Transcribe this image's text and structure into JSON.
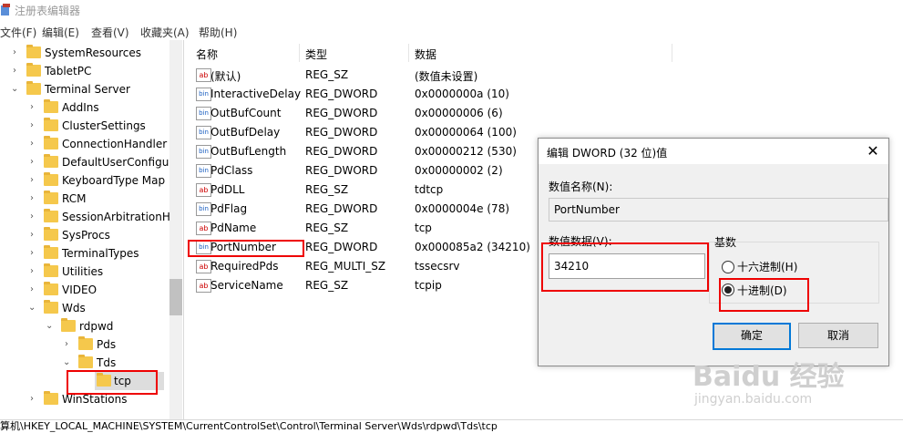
{
  "window": {
    "title": "注册表编辑器"
  },
  "menu": [
    "文件(F)",
    "编辑(E)",
    "查看(V)",
    "收藏夹(A)",
    "帮助(H)"
  ],
  "tree": [
    {
      "label": "SystemResources",
      "chev": "›"
    },
    {
      "label": "TabletPC",
      "chev": "›"
    },
    {
      "label": "Terminal Server",
      "chev": "⌄"
    },
    {
      "label": "AddIns",
      "chev": "›"
    },
    {
      "label": "ClusterSettings",
      "chev": "›"
    },
    {
      "label": "ConnectionHandler",
      "chev": "›"
    },
    {
      "label": "DefaultUserConfigur",
      "chev": "›"
    },
    {
      "label": "KeyboardType Map",
      "chev": "›"
    },
    {
      "label": "RCM",
      "chev": "›"
    },
    {
      "label": "SessionArbitrationH",
      "chev": "›"
    },
    {
      "label": "SysProcs",
      "chev": "›"
    },
    {
      "label": "TerminalTypes",
      "chev": "›"
    },
    {
      "label": "Utilities",
      "chev": "›"
    },
    {
      "label": "VIDEO",
      "chev": "›"
    },
    {
      "label": "Wds",
      "chev": "⌄"
    },
    {
      "label": "rdpwd",
      "chev": "⌄"
    },
    {
      "label": "Pds",
      "chev": "›"
    },
    {
      "label": "Tds",
      "chev": "⌄"
    },
    {
      "label": "tcp",
      "chev": ""
    },
    {
      "label": "WinStations",
      "chev": "›"
    }
  ],
  "list": {
    "headers": [
      "名称",
      "类型",
      "数据"
    ],
    "rows": [
      {
        "name": "(默认)",
        "type": "REG_SZ",
        "data": "(数值未设置)",
        "icon": "ab"
      },
      {
        "name": "InteractiveDelay",
        "type": "REG_DWORD",
        "data": "0x0000000a (10)",
        "icon": "bin"
      },
      {
        "name": "OutBufCount",
        "type": "REG_DWORD",
        "data": "0x00000006 (6)",
        "icon": "bin"
      },
      {
        "name": "OutBufDelay",
        "type": "REG_DWORD",
        "data": "0x00000064 (100)",
        "icon": "bin"
      },
      {
        "name": "OutBufLength",
        "type": "REG_DWORD",
        "data": "0x00000212 (530)",
        "icon": "bin"
      },
      {
        "name": "PdClass",
        "type": "REG_DWORD",
        "data": "0x00000002 (2)",
        "icon": "bin"
      },
      {
        "name": "PdDLL",
        "type": "REG_SZ",
        "data": "tdtcp",
        "icon": "ab"
      },
      {
        "name": "PdFlag",
        "type": "REG_DWORD",
        "data": "0x0000004e (78)",
        "icon": "bin"
      },
      {
        "name": "PdName",
        "type": "REG_SZ",
        "data": "tcp",
        "icon": "ab"
      },
      {
        "name": "PortNumber",
        "type": "REG_DWORD",
        "data": "0x000085a2 (34210)",
        "icon": "bin"
      },
      {
        "name": "RequiredPds",
        "type": "REG_MULTI_SZ",
        "data": "tssecsrv",
        "icon": "ab"
      },
      {
        "name": "ServiceName",
        "type": "REG_SZ",
        "data": "tcpip",
        "icon": "ab"
      }
    ]
  },
  "status": "算机\\HKEY_LOCAL_MACHINE\\SYSTEM\\CurrentControlSet\\Control\\Terminal Server\\Wds\\rdpwd\\Tds\\tcp",
  "dialog": {
    "title": "编辑 DWORD (32 位)值",
    "close": "✕",
    "value_name_label": "数值名称(N):",
    "value_name": "PortNumber",
    "value_data_label": "数值数据(V):",
    "value_data": "34210",
    "base_label": "基数",
    "hex_label": "十六进制(H)",
    "dec_label": "十进制(D)",
    "selected_base": "decimal",
    "ok": "确定",
    "cancel": "取消"
  },
  "watermark": {
    "brand": "Baidu 经验",
    "url": "jingyan.baidu.com"
  },
  "colors": {
    "highlight": "#e00000",
    "accent": "#0078d7",
    "folder": "#f5c84c"
  }
}
